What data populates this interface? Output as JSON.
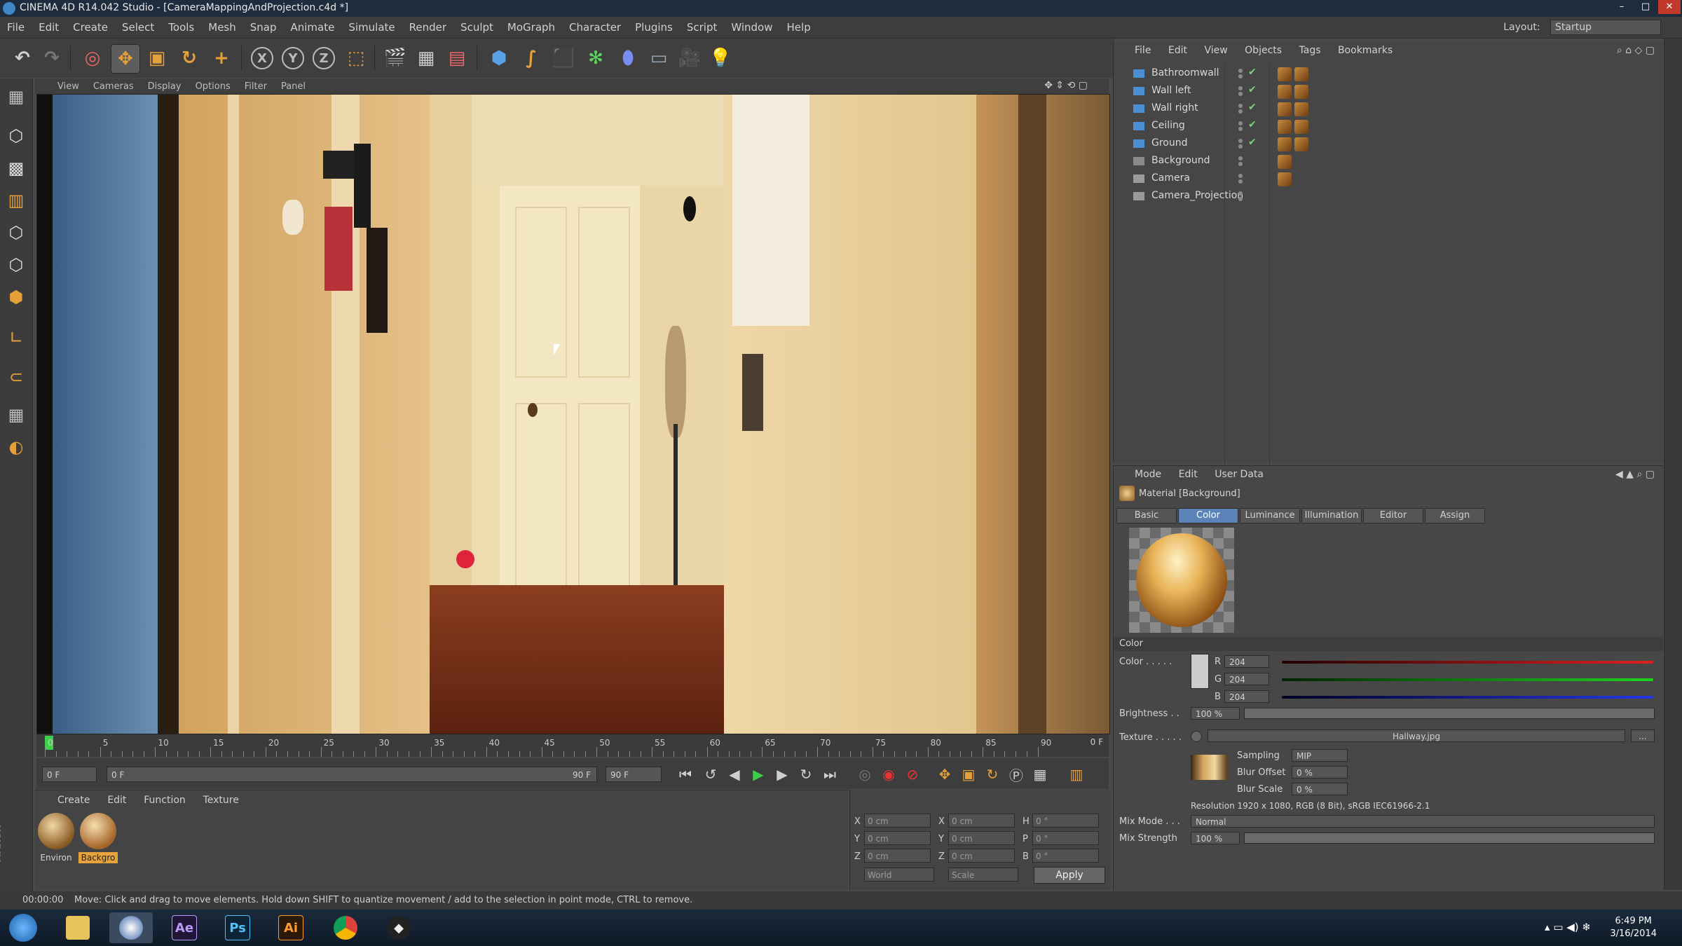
{
  "window": {
    "title": "CINEMA 4D R14.042 Studio - [CameraMappingAndProjection.c4d *]",
    "controls": [
      "–",
      "□",
      "✕"
    ]
  },
  "menubar": {
    "items": [
      "File",
      "Edit",
      "Create",
      "Select",
      "Tools",
      "Mesh",
      "Snap",
      "Animate",
      "Simulate",
      "Render",
      "Sculpt",
      "MoGraph",
      "Character",
      "Plugins",
      "Script",
      "Window",
      "Help"
    ],
    "layout_label": "Layout:",
    "layout_value": "Startup"
  },
  "viewport": {
    "menu": [
      "View",
      "Cameras",
      "Display",
      "Options",
      "Filter",
      "Panel"
    ]
  },
  "timeline": {
    "ticks": [
      "0",
      "5",
      "10",
      "15",
      "20",
      "25",
      "30",
      "35",
      "40",
      "45",
      "50",
      "55",
      "60",
      "65",
      "70",
      "75",
      "80",
      "85",
      "90"
    ],
    "current_frame_label": "0 F"
  },
  "transport": {
    "start_field": "0 F",
    "range_start": "0 F",
    "range_end": "90 F",
    "end_field": "90 F"
  },
  "material_manager": {
    "menu": [
      "Create",
      "Edit",
      "Function",
      "Texture"
    ],
    "materials": [
      {
        "name": "Environ",
        "selected": false
      },
      {
        "name": "Backgro",
        "selected": true
      }
    ]
  },
  "coordinates": {
    "rows": [
      {
        "a": "X",
        "av": "0 cm",
        "b": "X",
        "bv": "0 cm",
        "c": "H",
        "cv": "0 °"
      },
      {
        "a": "Y",
        "av": "0 cm",
        "b": "Y",
        "bv": "0 cm",
        "c": "P",
        "cv": "0 °"
      },
      {
        "a": "Z",
        "av": "0 cm",
        "b": "Z",
        "bv": "0 cm",
        "c": "B",
        "cv": "0 °"
      }
    ],
    "mode1": "World",
    "mode2": "Scale",
    "apply_label": "Apply"
  },
  "statusbar": {
    "time": "00:00:00",
    "message": "Move: Click and drag to move elements. Hold down SHIFT to quantize movement / add to the selection in point mode, CTRL to remove."
  },
  "object_manager": {
    "menu": [
      "File",
      "Edit",
      "View",
      "Objects",
      "Tags",
      "Bookmarks"
    ],
    "objects": [
      {
        "name": "Bathroomwall",
        "icon": "cube-icon",
        "checked": true,
        "tags": 2
      },
      {
        "name": "Wall left",
        "icon": "cube-icon",
        "checked": true,
        "tags": 2
      },
      {
        "name": "Wall right",
        "icon": "cube-icon",
        "checked": true,
        "tags": 2
      },
      {
        "name": "Ceiling",
        "icon": "cube-icon",
        "checked": true,
        "tags": 2
      },
      {
        "name": "Ground",
        "icon": "cube-icon",
        "checked": true,
        "tags": 2
      },
      {
        "name": "Background",
        "icon": "background-icon",
        "checked": false,
        "tags": 1
      },
      {
        "name": "Camera",
        "icon": "camera-icon",
        "checked": false,
        "tags": 1
      },
      {
        "name": "Camera_Projection",
        "icon": "camera-icon",
        "checked": false,
        "tags": 0
      }
    ]
  },
  "attribute_manager": {
    "menu": [
      "Mode",
      "Edit",
      "User Data"
    ],
    "title": "Material [Background]",
    "tabs": [
      "Basic",
      "Color",
      "Luminance",
      "Illumination",
      "Editor",
      "Assign"
    ],
    "active_tab": "Color",
    "section_title": "Color",
    "color_label": "Color . . . . .",
    "r_label": "R",
    "r_value": "204",
    "g_label": "G",
    "g_value": "204",
    "b_label": "B",
    "b_value": "204",
    "brightness_label": "Brightness . .",
    "brightness_value": "100 %",
    "texture_label": "Texture . . . . .",
    "texture_file": "Hallway.jpg",
    "texture_more": "...",
    "sampling_label": "Sampling",
    "sampling_value": "MIP",
    "blur_offset_label": "Blur Offset",
    "blur_offset_value": "0 %",
    "blur_scale_label": "Blur Scale",
    "blur_scale_value": "0 %",
    "resolution": "Resolution 1920 x 1080, RGB (8 Bit), sRGB IEC61966-2.1",
    "mix_mode_label": "Mix Mode . . .",
    "mix_mode_value": "Normal",
    "mix_strength_label": "Mix Strength",
    "mix_strength_value": "100 %"
  },
  "taskbar": {
    "apps": [
      {
        "name": "start-button",
        "label": ""
      },
      {
        "name": "explorer",
        "label": ""
      },
      {
        "name": "cinema4d",
        "label": ""
      },
      {
        "name": "after-effects",
        "label": "Ae"
      },
      {
        "name": "photoshop",
        "label": "Ps"
      },
      {
        "name": "illustrator",
        "label": "Ai"
      },
      {
        "name": "chrome",
        "label": ""
      },
      {
        "name": "unity",
        "label": ""
      }
    ],
    "time": "6:49 PM",
    "date": "3/16/2014"
  },
  "colors": {
    "accent": "#5b83b8",
    "selection": "#e8a33a",
    "playhead": "#3dcf4c"
  }
}
